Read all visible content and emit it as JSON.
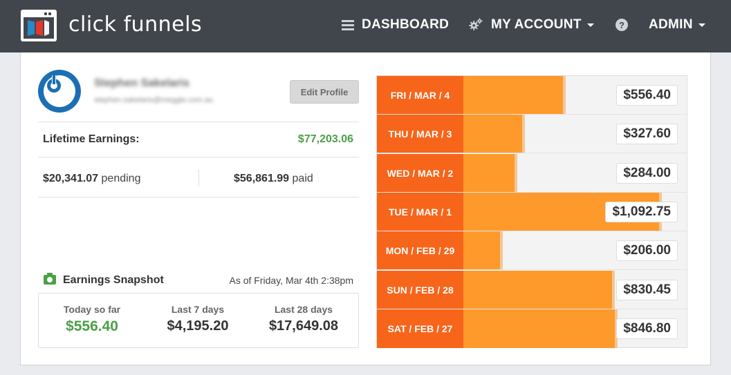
{
  "header": {
    "brand": "click funnels",
    "nav": {
      "dashboard": "DASHBOARD",
      "my_account": "MY ACCOUNT",
      "help": "?",
      "admin": "ADMIN"
    }
  },
  "profile": {
    "name": "Stephen Sakelaris",
    "email": "stephen.sakelaris@meggle.com.au",
    "edit_button": "Edit Profile"
  },
  "earnings": {
    "lifetime_label": "Lifetime Earnings:",
    "lifetime_value": "$77,203.06",
    "pending_amount": "$20,341.07",
    "pending_label": "pending",
    "paid_amount": "$56,861.99",
    "paid_label": "paid"
  },
  "snapshot": {
    "title": "Earnings Snapshot",
    "as_of": "As of Friday, Mar 4th 2:38pm",
    "stats": [
      {
        "label": "Today so far",
        "value": "$556.40"
      },
      {
        "label": "Last 7 days",
        "value": "$4,195.20"
      },
      {
        "label": "Last 28 days",
        "value": "$17,649.08"
      }
    ]
  },
  "colors": {
    "header_bg": "#41464d",
    "accent_green": "#4aa046",
    "day_orange": "#f7651b",
    "bar_orange": "#fd9a2b"
  },
  "chart_data": {
    "type": "bar",
    "orientation": "horizontal",
    "max_value": 1250,
    "days": [
      {
        "label": "FRI / MAR / 4",
        "amount": "$556.40",
        "value": 556.4
      },
      {
        "label": "THU / MAR / 3",
        "amount": "$327.60",
        "value": 327.6
      },
      {
        "label": "WED / MAR / 2",
        "amount": "$284.00",
        "value": 284.0
      },
      {
        "label": "TUE / MAR / 1",
        "amount": "$1,092.75",
        "value": 1092.75
      },
      {
        "label": "MON / FEB / 29",
        "amount": "$206.00",
        "value": 206.0
      },
      {
        "label": "SUN / FEB / 28",
        "amount": "$830.45",
        "value": 830.45
      },
      {
        "label": "SAT / FEB / 27",
        "amount": "$846.80",
        "value": 846.8
      }
    ]
  }
}
